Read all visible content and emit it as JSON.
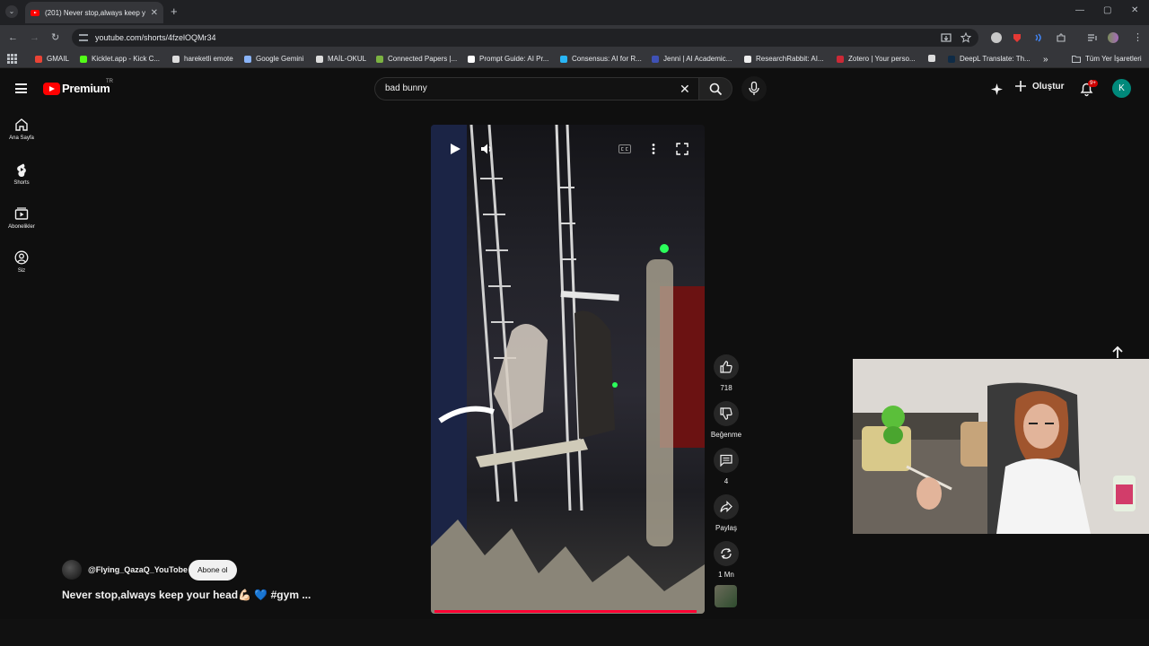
{
  "browser": {
    "tab_title": "(201) Never stop,always keep y",
    "tab_close": "✕",
    "new_tab": "+",
    "url": "youtube.com/shorts/4fzelOQMr34",
    "window_controls": {
      "minimize": "—",
      "restore": "▢",
      "close": "✕"
    },
    "bookmarks": [
      {
        "label": "GMAIL",
        "color": "#ea4335"
      },
      {
        "label": "Kicklet.app - Kick C...",
        "color": "#53fc18"
      },
      {
        "label": "hareketli emote",
        "color": "#dddddd"
      },
      {
        "label": "Google Gemini",
        "color": "#8ab4f8"
      },
      {
        "label": "MAİL-OKUL",
        "color": "#dddddd"
      },
      {
        "label": "Connected Papers |...",
        "color": "#7cb342"
      },
      {
        "label": "Prompt Guide: AI Pr...",
        "color": "#ffffff"
      },
      {
        "label": "Consensus: AI for R...",
        "color": "#29b6f6"
      },
      {
        "label": "Jenni | AI Academic...",
        "color": "#3f51b5"
      },
      {
        "label": "ResearchRabbit: AI...",
        "color": "#eeeeee"
      },
      {
        "label": "Zotero | Your perso...",
        "color": "#cc2936"
      },
      {
        "label": "",
        "color": "#dddddd"
      },
      {
        "label": "DeepL Translate: Th...",
        "color": "#0f2b46"
      }
    ],
    "bookmarks_more": "»",
    "all_bookmarks": "Tüm Yer İşaretleri"
  },
  "header": {
    "logo": "Premium",
    "logo_region": "TR",
    "search_value": "bad bunny",
    "create_label": "Oluştur",
    "notifications_badge": "9+",
    "avatar_letter": "K"
  },
  "sidebar": {
    "items": [
      {
        "label": "Ana Sayfa",
        "icon": "home-icon"
      },
      {
        "label": "Shorts",
        "icon": "shorts-icon"
      },
      {
        "label": "Abonelikler",
        "icon": "subscriptions-icon"
      },
      {
        "label": "Siz",
        "icon": "you-icon"
      }
    ]
  },
  "short": {
    "channel": "@Flying_QazaQ_YouTobe",
    "subscribe_label": "Abone ol",
    "title": "Never stop,always keep your head💪🏻 💙 #gym ...",
    "progress": 0.99
  },
  "actions": {
    "like_count": "718",
    "dislike_label": "Beğenme",
    "comments_count": "4",
    "share_label": "Paylaş",
    "remix_label": "1 Mn"
  },
  "colors": {
    "accent": "#ff0033",
    "background": "#0f0f0f",
    "avatar": "#00897b"
  }
}
